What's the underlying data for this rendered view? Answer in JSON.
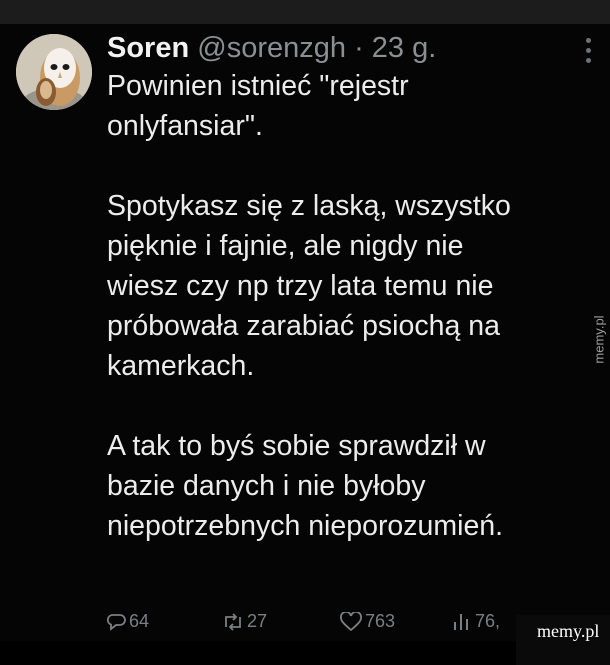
{
  "tweet": {
    "author_name": "Soren",
    "handle": "@sorenzgh",
    "separator": "·",
    "time": "23 g.",
    "body": {
      "p1_l1": "Powinien istnieć \"rejestr",
      "p1_l2": "onlyfansiar\".",
      "p2_l1": "Spotykasz się z laską, wszystko",
      "p2_l2": "pięknie i fajnie, ale nigdy nie",
      "p2_l3": "wiesz czy np trzy lata temu nie",
      "p2_l4": "próbowała zarabiać psiochą na",
      "p2_l5": "kamerkach.",
      "p3_l1": "A tak to byś sobie sprawdził w",
      "p3_l2": "bazie danych i nie byłoby",
      "p3_l3": "niepotrzebnych nieporozumień."
    },
    "actions": {
      "replies": "64",
      "retweets": "27",
      "likes": "763",
      "views": "76,"
    },
    "icons": {
      "reply": "reply-icon",
      "retweet": "retweet-icon",
      "like": "heart-icon",
      "views": "views-icon",
      "more": "more-icon"
    }
  },
  "watermark": {
    "side": "memy.pl",
    "corner": "memy.pl"
  },
  "colors": {
    "background": "#050505",
    "text": "#ececec",
    "muted": "#8b8f93",
    "icon": "#7b7f83"
  }
}
